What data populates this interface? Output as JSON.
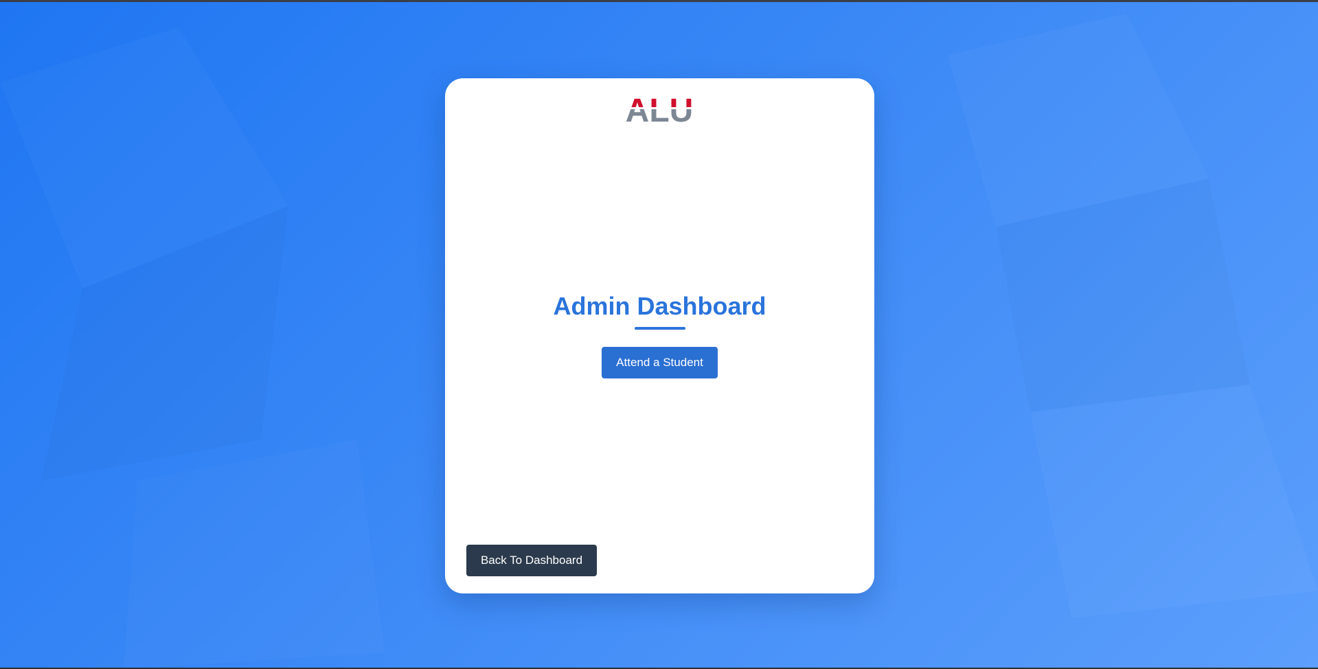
{
  "page": {
    "background_start": "#1f76f2",
    "background_end": "#5c9ffc"
  },
  "logo": {
    "text": "ALU",
    "top_color": "#d0102e",
    "bottom_color": "#7d8794"
  },
  "main": {
    "title": "Admin Dashboard",
    "accent_color": "#2a74db",
    "attend_button_label": "Attend a Student"
  },
  "footer": {
    "back_button_label": "Back To Dashboard"
  }
}
